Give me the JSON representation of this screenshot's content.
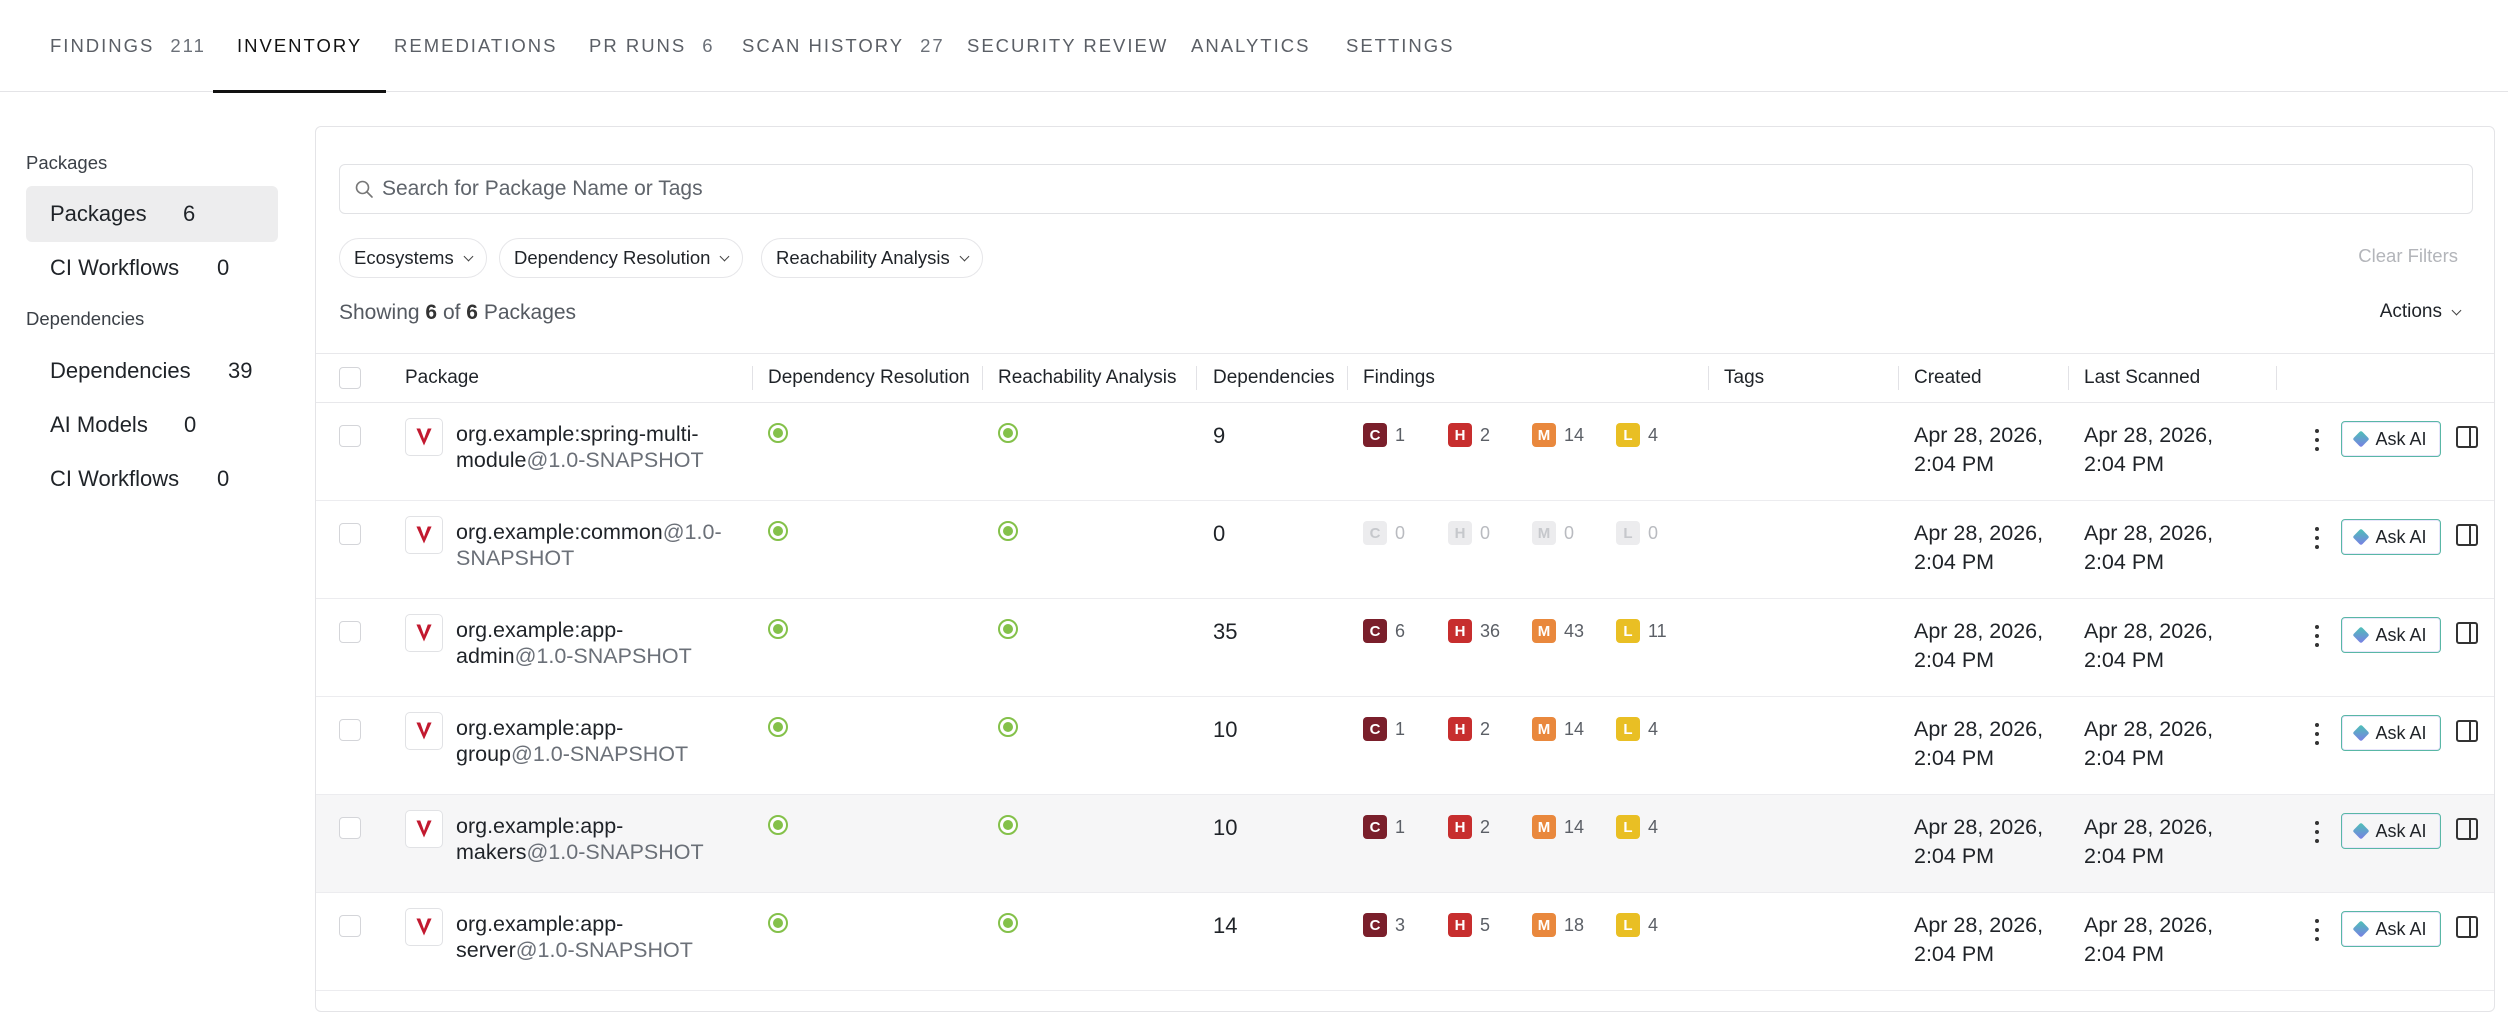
{
  "nav": {
    "tabs": [
      {
        "label": "FINDINGS",
        "count": "211"
      },
      {
        "label": "INVENTORY",
        "count": ""
      },
      {
        "label": "REMEDIATIONS",
        "count": ""
      },
      {
        "label": "PR RUNS",
        "count": "6"
      },
      {
        "label": "SCAN HISTORY",
        "count": "27"
      },
      {
        "label": "SECURITY REVIEW",
        "count": ""
      },
      {
        "label": "ANALYTICS",
        "count": ""
      },
      {
        "label": "SETTINGS",
        "count": ""
      }
    ],
    "active": "INVENTORY"
  },
  "sidebar": {
    "packages_heading": "Packages",
    "packages_items": [
      {
        "label": "Packages",
        "count": "6"
      },
      {
        "label": "CI Workflows",
        "count": "0"
      }
    ],
    "dependencies_heading": "Dependencies",
    "dependencies_items": [
      {
        "label": "Dependencies",
        "count": "39"
      },
      {
        "label": "AI Models",
        "count": "0"
      },
      {
        "label": "CI Workflows",
        "count": "0"
      }
    ]
  },
  "search": {
    "placeholder": "Search for Package Name or Tags"
  },
  "filters": {
    "ecosystems": "Ecosystems",
    "dependency_resolution": "Dependency Resolution",
    "reachability_analysis": "Reachability Analysis",
    "clear": "Clear Filters"
  },
  "summary": {
    "prefix": "Showing",
    "shown": "6",
    "of": "of",
    "total": "6",
    "suffix": "Packages"
  },
  "actions_label": "Actions",
  "table": {
    "headers": {
      "package": "Package",
      "dependency_resolution": "Dependency Resolution",
      "reachability_analysis": "Reachability Analysis",
      "dependencies": "Dependencies",
      "findings": "Findings",
      "tags": "Tags",
      "created": "Created",
      "last_scanned": "Last Scanned"
    },
    "severity_letters": {
      "c": "C",
      "h": "H",
      "m": "M",
      "l": "L"
    },
    "ask_ai_label": "Ask AI",
    "rows": [
      {
        "name_line1": "org.example:spring-multi-",
        "name_line2": "module",
        "version": "@1.0-SNAPSHOT",
        "deps": "9",
        "c": "1",
        "h": "2",
        "m": "14",
        "l": "4",
        "created_1": "Apr 28, 2026,",
        "created_2": "2:04 PM",
        "scanned_1": "Apr 28, 2026,",
        "scanned_2": "2:04 PM"
      },
      {
        "name_line1": "org.example:common",
        "name_line2": "",
        "version": "@1.0-SNAPSHOT",
        "deps": "0",
        "c": "0",
        "h": "0",
        "m": "0",
        "l": "0",
        "created_1": "Apr 28, 2026,",
        "created_2": "2:04 PM",
        "scanned_1": "Apr 28, 2026,",
        "scanned_2": "2:04 PM"
      },
      {
        "name_line1": "org.example:app-",
        "name_line2": "admin",
        "version": "@1.0-SNAPSHOT",
        "deps": "35",
        "c": "6",
        "h": "36",
        "m": "43",
        "l": "11",
        "created_1": "Apr 28, 2026,",
        "created_2": "2:04 PM",
        "scanned_1": "Apr 28, 2026,",
        "scanned_2": "2:04 PM"
      },
      {
        "name_line1": "org.example:app-",
        "name_line2": "group",
        "version": "@1.0-SNAPSHOT",
        "deps": "10",
        "c": "1",
        "h": "2",
        "m": "14",
        "l": "4",
        "created_1": "Apr 28, 2026,",
        "created_2": "2:04 PM",
        "scanned_1": "Apr 28, 2026,",
        "scanned_2": "2:04 PM"
      },
      {
        "name_line1": "org.example:app-",
        "name_line2": "makers",
        "version": "@1.0-SNAPSHOT",
        "deps": "10",
        "c": "1",
        "h": "2",
        "m": "14",
        "l": "4",
        "created_1": "Apr 28, 2026,",
        "created_2": "2:04 PM",
        "scanned_1": "Apr 28, 2026,",
        "scanned_2": "2:04 PM"
      },
      {
        "name_line1": "org.example:app-",
        "name_line2": "server",
        "version": "@1.0-SNAPSHOT",
        "deps": "14",
        "c": "3",
        "h": "5",
        "m": "18",
        "l": "4",
        "created_1": "Apr 28, 2026,",
        "created_2": "2:04 PM",
        "scanned_1": "Apr 28, 2026,",
        "scanned_2": "2:04 PM"
      }
    ]
  },
  "colors": {
    "critical": "#7a1f2b",
    "high": "#c72e2e",
    "medium": "#e9883d",
    "low": "#e9bf24",
    "resolution_ok": "#84c14a",
    "ask_ai_border": "#59b7a6"
  },
  "icons": {
    "search": "search-icon",
    "package": "maven-icon",
    "status": "status-dot-icon",
    "more": "more-vertical-icon",
    "ai": "sparkle-icon",
    "side_panel": "side-panel-icon",
    "dropdown": "chevron-down-icon"
  }
}
